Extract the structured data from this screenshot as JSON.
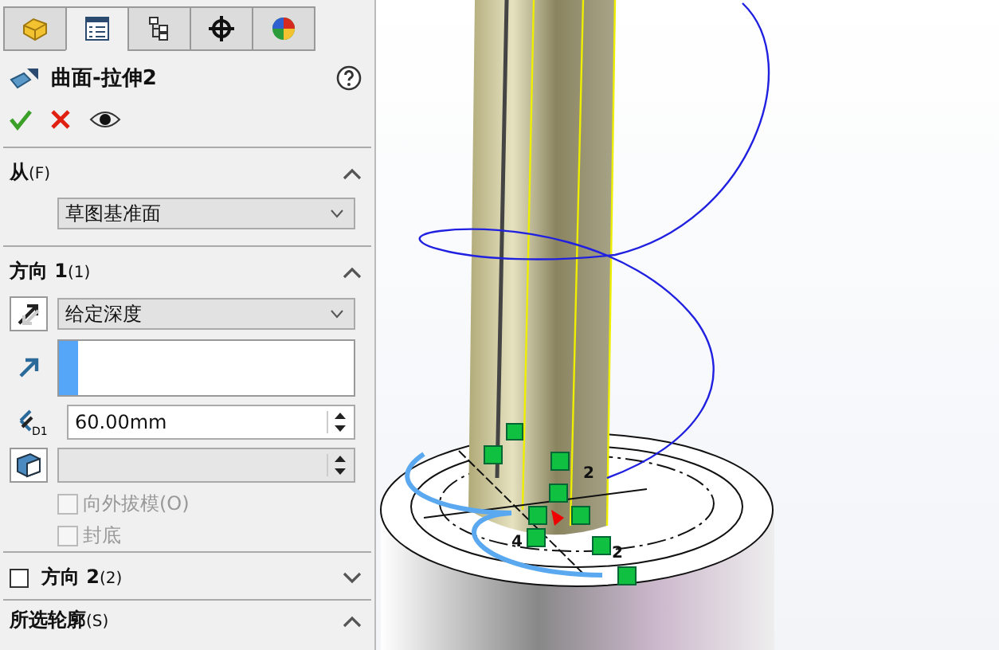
{
  "tabs": [
    {
      "kind": "feature",
      "selected": false
    },
    {
      "kind": "property",
      "selected": true
    },
    {
      "kind": "config",
      "selected": false
    },
    {
      "kind": "target",
      "selected": false
    },
    {
      "kind": "appearance",
      "selected": false
    }
  ],
  "feature": {
    "title": "曲面-拉伸2"
  },
  "from": {
    "label": "从",
    "shortcut": "(F)",
    "expanded": true,
    "value": "草图基准面"
  },
  "direction1": {
    "label": "方向 1",
    "shortcut": "(1)",
    "expanded": true,
    "end_condition": "给定深度",
    "depth": "60.00mm",
    "depth_icon_label": "D1",
    "draft_disabled": true,
    "options": [
      {
        "label": "向外拔模(O)",
        "checked": false,
        "disabled": true
      },
      {
        "label": "封底",
        "checked": false,
        "disabled": true
      }
    ]
  },
  "direction2": {
    "label": "方向 2",
    "shortcut": "(2)",
    "checked": false,
    "expanded": false
  },
  "contours": {
    "label": "所选轮廓",
    "shortcut": "(S)",
    "expanded": true
  },
  "viewport": {
    "relation_labels": [
      "2",
      "4",
      "2"
    ]
  }
}
